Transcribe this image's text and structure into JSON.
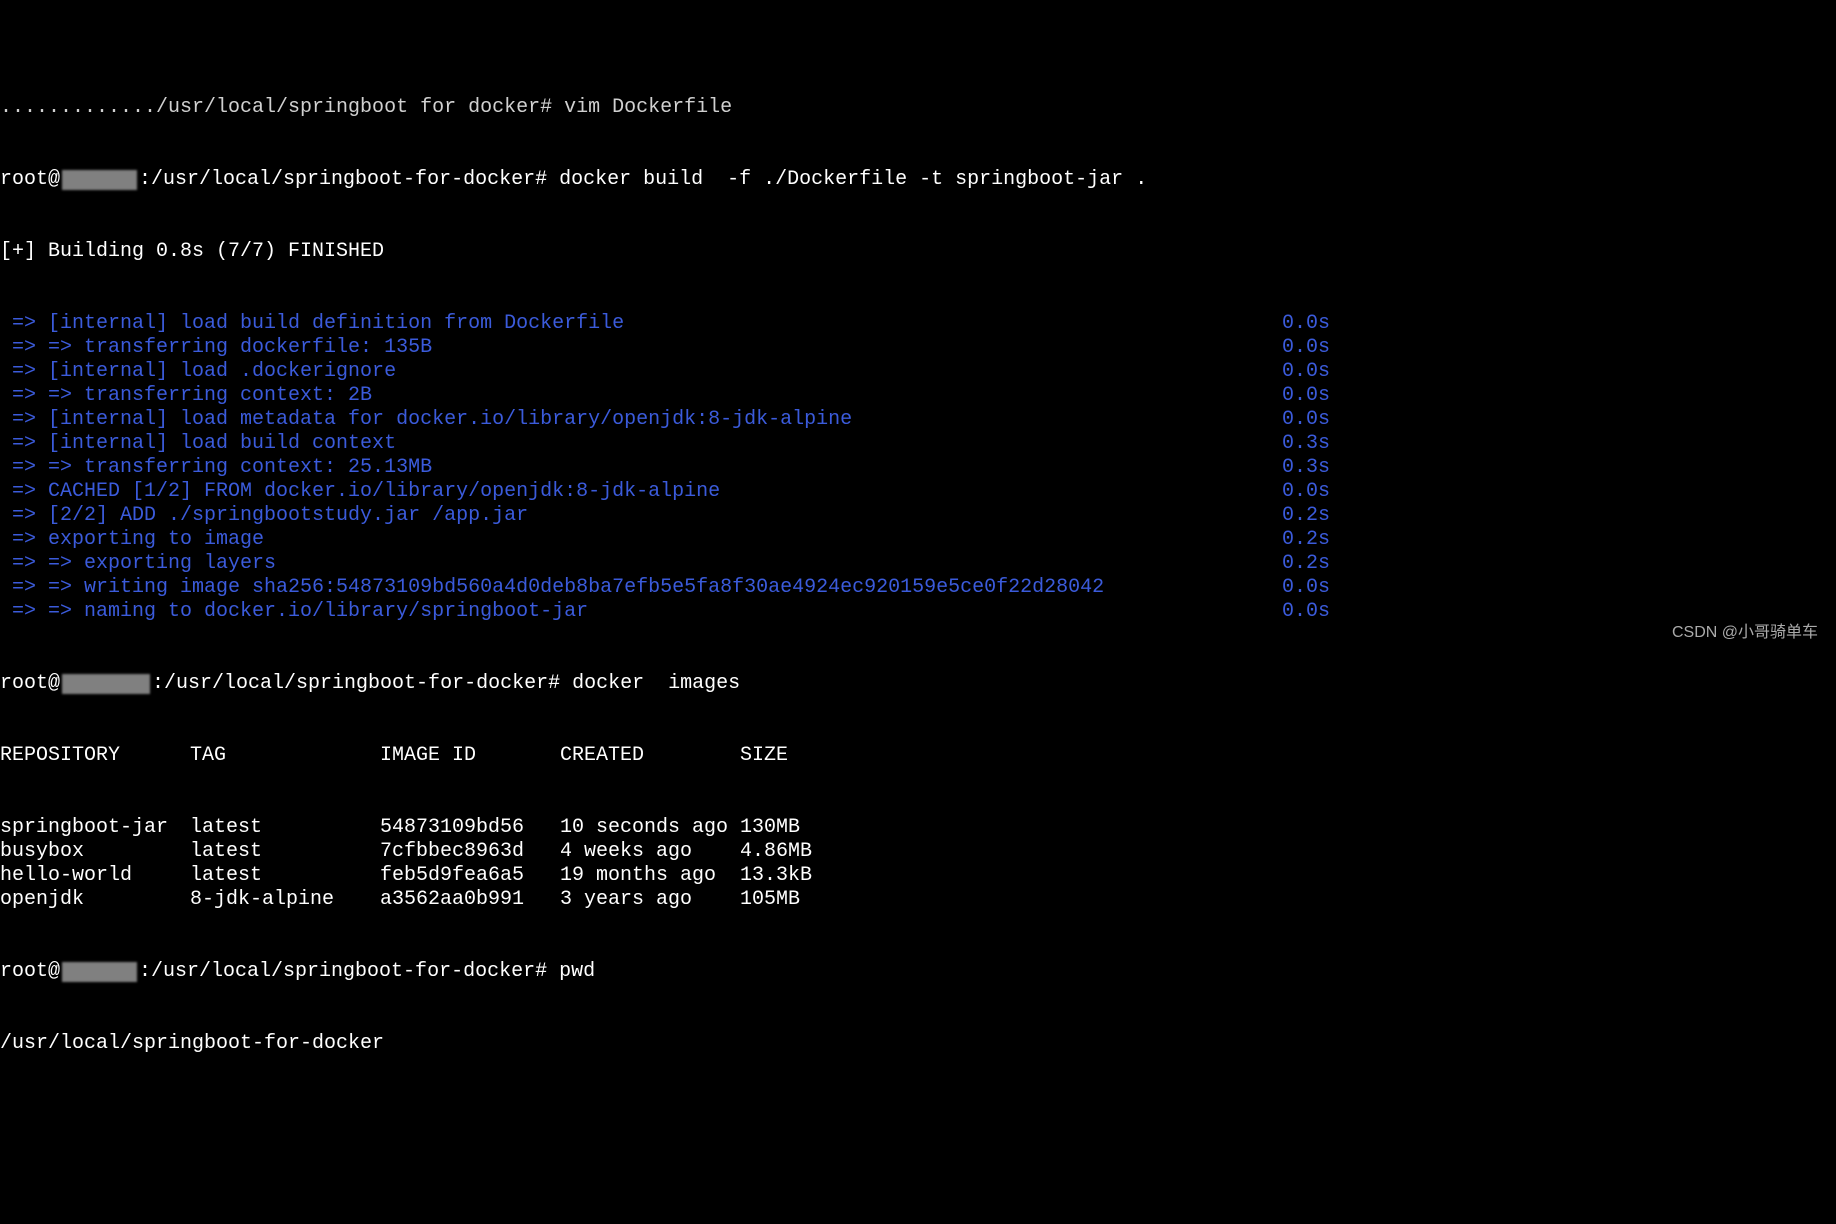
{
  "truncated_top": "............./usr/local/springboot for docker# vim Dockerfile",
  "prompt1": {
    "user": "root@",
    "path": ":/usr/local/springboot-for-docker#",
    "cmd": " docker build  -f ./Dockerfile -t springboot-jar ."
  },
  "building": "[+] Building 0.8s (7/7) FINISHED",
  "steps": [
    {
      "text": "=> [internal] load build definition from Dockerfile",
      "time": "0.0s"
    },
    {
      "text": "=> => transferring dockerfile: 135B",
      "time": "0.0s"
    },
    {
      "text": "=> [internal] load .dockerignore",
      "time": "0.0s"
    },
    {
      "text": "=> => transferring context: 2B",
      "time": "0.0s"
    },
    {
      "text": "=> [internal] load metadata for docker.io/library/openjdk:8-jdk-alpine",
      "time": "0.0s"
    },
    {
      "text": "=> [internal] load build context",
      "time": "0.3s"
    },
    {
      "text": "=> => transferring context: 25.13MB",
      "time": "0.3s"
    },
    {
      "text": "=> CACHED [1/2] FROM docker.io/library/openjdk:8-jdk-alpine",
      "time": "0.0s"
    },
    {
      "text": "=> [2/2] ADD ./springbootstudy.jar /app.jar",
      "time": "0.2s"
    },
    {
      "text": "=> exporting to image",
      "time": "0.2s"
    },
    {
      "text": "=> => exporting layers",
      "time": "0.2s"
    },
    {
      "text": "=> => writing image sha256:54873109bd560a4d0deb8ba7efb5e5fa8f30ae4924ec920159e5ce0f22d28042",
      "time": "0.0s"
    },
    {
      "text": "=> => naming to docker.io/library/springboot-jar",
      "time": "0.0s"
    }
  ],
  "prompt2": {
    "user": "root@",
    "path": ":/usr/local/springboot-for-docker#",
    "cmd": " docker  images"
  },
  "images_table": {
    "headers": {
      "repo": "REPOSITORY",
      "tag": "TAG",
      "image": "IMAGE ID",
      "created": "CREATED",
      "size": "SIZE"
    },
    "rows": [
      {
        "repo": "springboot-jar",
        "tag": "latest",
        "image": "54873109bd56",
        "created": "10 seconds ago",
        "size": "130MB"
      },
      {
        "repo": "busybox",
        "tag": "latest",
        "image": "7cfbbec8963d",
        "created": "4 weeks ago",
        "size": "4.86MB"
      },
      {
        "repo": "hello-world",
        "tag": "latest",
        "image": "feb5d9fea6a5",
        "created": "19 months ago",
        "size": "13.3kB"
      },
      {
        "repo": "openjdk",
        "tag": "8-jdk-alpine",
        "image": "a3562aa0b991",
        "created": "3 years ago",
        "size": "105MB"
      }
    ]
  },
  "prompt3": {
    "user": "root@",
    "path": ":/usr/local/springboot-for-docker#",
    "cmd": " pwd"
  },
  "pwd_output": "/usr/local/springboot-for-docker",
  "watermark": "CSDN @小哥骑单车"
}
